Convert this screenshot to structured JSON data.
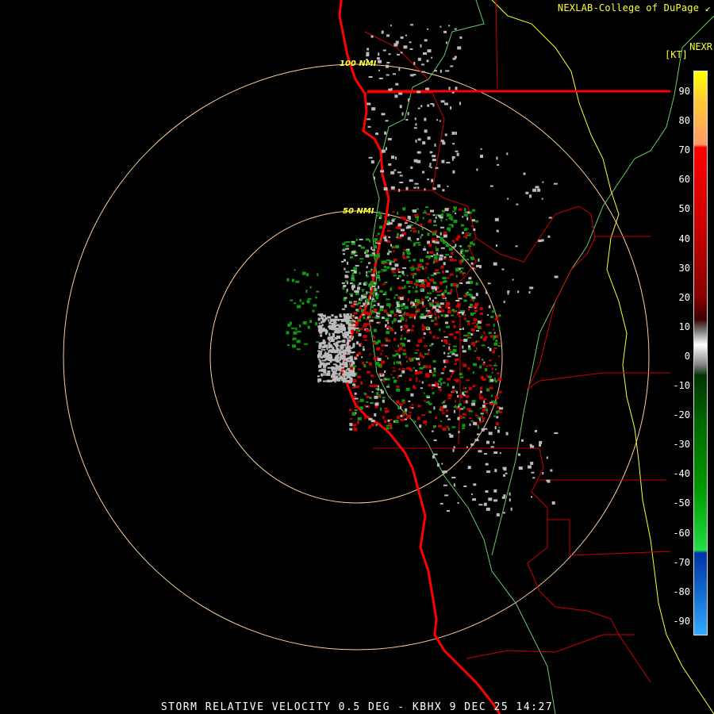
{
  "header": {
    "credit": "NEXLAB-College of DuPage",
    "product": "NEXR",
    "units": "[KT]"
  },
  "footer": {
    "caption": "STORM RELATIVE VELOCITY 0.5 DEG - KBHX 9 DEC 25 14:27"
  },
  "range_rings": [
    {
      "label": "50 NMI"
    },
    {
      "label": "100 NMI"
    }
  ],
  "legend": {
    "ticks": [
      "90",
      "80",
      "70",
      "60",
      "50",
      "40",
      "30",
      "20",
      "10",
      "0",
      "-10",
      "-20",
      "-30",
      "-40",
      "-50",
      "-60",
      "-70",
      "-80",
      "-90"
    ]
  },
  "colors": {
    "background": "#000000",
    "coastline": "#ff0000",
    "county_lines": "#cc0000",
    "rivers": "#66cc66",
    "yellow_border": "#ffff33",
    "range_rings": "#ffcc99",
    "outbound": "#cc0000",
    "inbound": "#119911",
    "near_zero": "#bbbbbb"
  }
}
